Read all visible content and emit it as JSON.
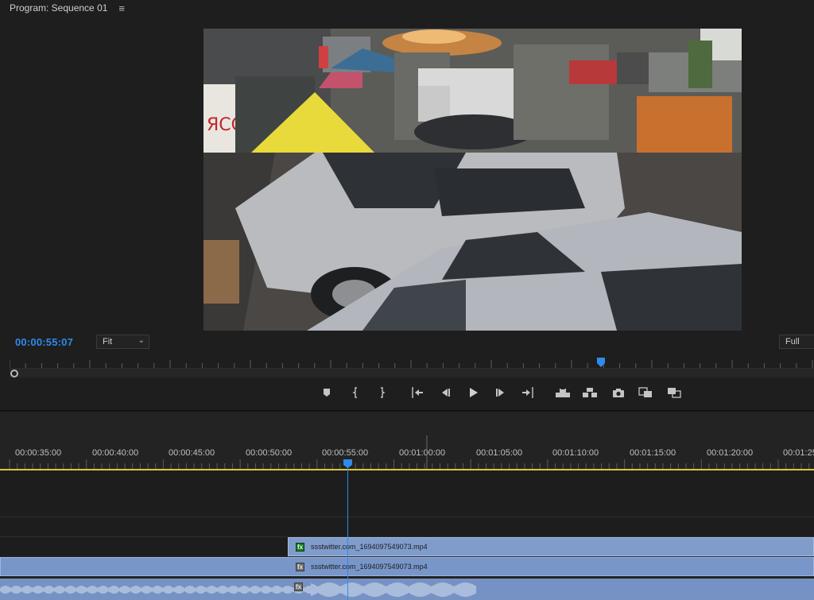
{
  "monitor": {
    "title": "Program: Sequence 01",
    "menu_icon": "hamburger-menu-icon",
    "timecode": "00:00:55:07",
    "zoom_select": "Fit",
    "resolution_select": "Full"
  },
  "transport": {
    "buttons": [
      {
        "name": "add-marker-icon"
      },
      {
        "name": "mark-in-icon"
      },
      {
        "name": "mark-out-icon"
      },
      {
        "name": "go-to-in-icon"
      },
      {
        "name": "step-back-icon"
      },
      {
        "name": "play-icon"
      },
      {
        "name": "step-forward-icon"
      },
      {
        "name": "go-to-out-icon"
      },
      {
        "name": "lift-icon"
      },
      {
        "name": "extract-icon"
      },
      {
        "name": "export-frame-icon"
      },
      {
        "name": "comparison-view-icon"
      },
      {
        "name": "proxy-toggle-icon"
      }
    ]
  },
  "timeline": {
    "ruler_labels": [
      "00:00:35:00",
      "00:00:40:00",
      "00:00:45:00",
      "00:00:50:00",
      "00:00:55:00",
      "00:01:00:00",
      "00:01:05:00",
      "00:01:10:00",
      "00:01:15:00",
      "00:01:20:00",
      "00:01:25"
    ],
    "video_clip": {
      "label": "ssstwitter.com_1694097549073.mp4",
      "fx": "fx"
    },
    "linked_clip": {
      "label": "ssstwitter.com_1694097549073.mp4",
      "fx": "fx"
    },
    "audio_fx": "fx",
    "colors": {
      "accent": "#2d8ceb",
      "clip": "#7f9ccb",
      "work_area": "#d8c93a"
    }
  }
}
